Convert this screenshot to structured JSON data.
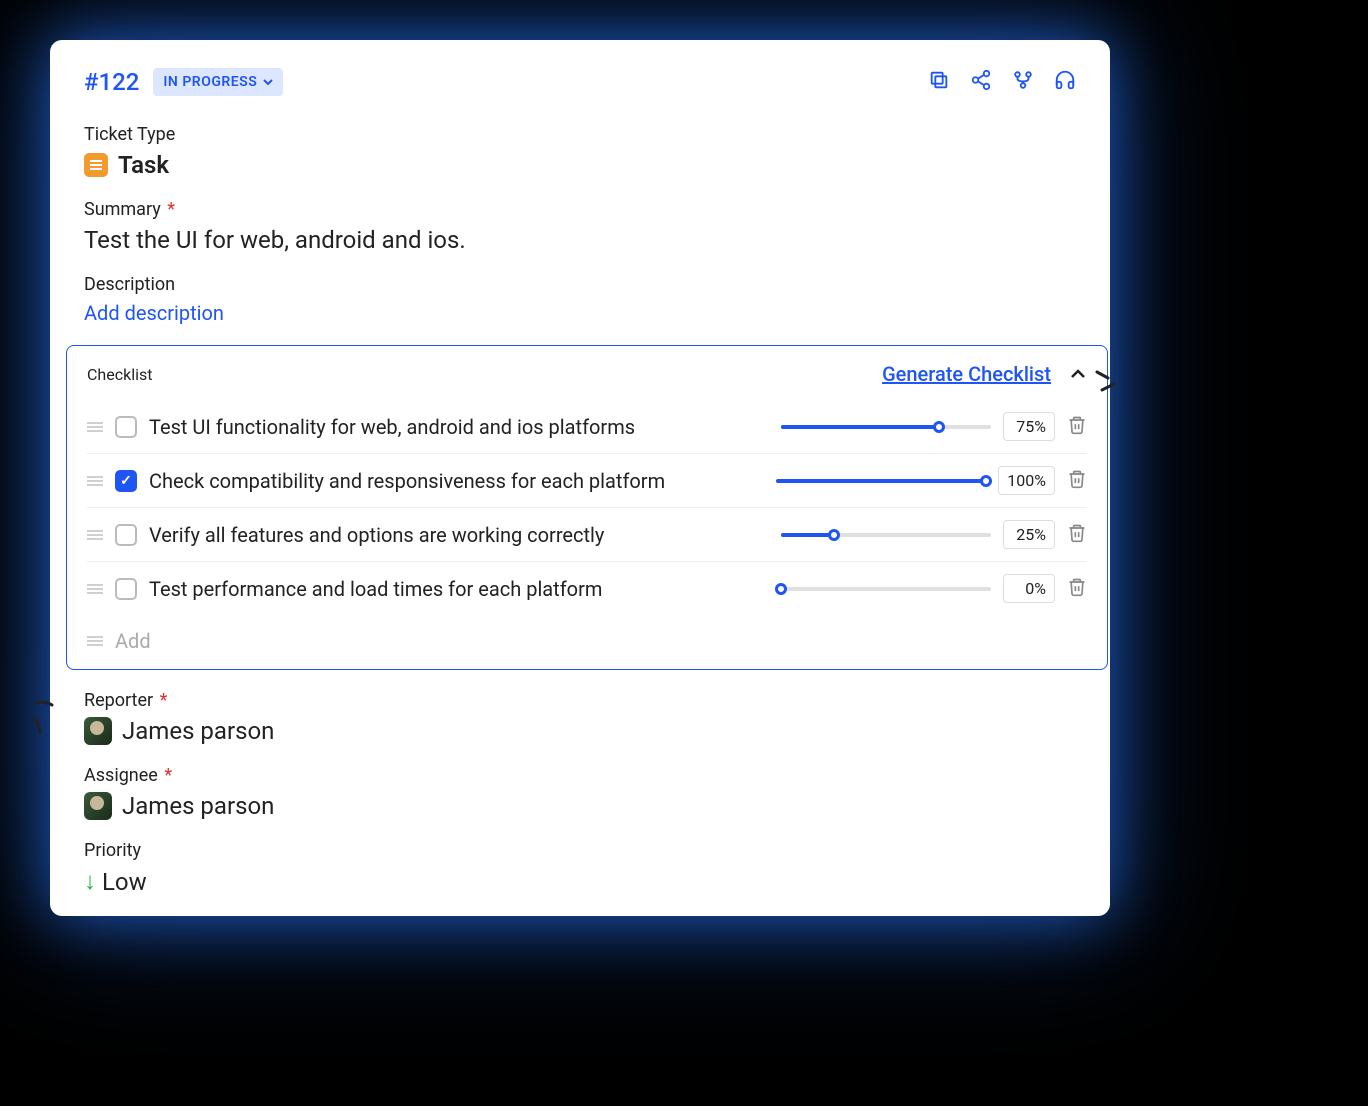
{
  "ticket": {
    "id": "#122",
    "status": "IN PROGRESS",
    "type_label": "Ticket Type",
    "type_value": "Task",
    "summary_label": "Summary",
    "summary_value": "Test the UI for web, android and ios.",
    "description_label": "Description",
    "add_description": "Add description"
  },
  "checklist": {
    "title": "Checklist",
    "generate": "Generate Checklist",
    "add_placeholder": "Add",
    "items": [
      {
        "text": "Test UI functionality for web, android and ios platforms",
        "checked": false,
        "pct": "75%",
        "pct_num": 75
      },
      {
        "text": "Check compatibility and responsiveness for each platform",
        "checked": true,
        "pct": "100%",
        "pct_num": 100
      },
      {
        "text": "Verify all features and options are working correctly",
        "checked": false,
        "pct": "25%",
        "pct_num": 25
      },
      {
        "text": "Test performance and load times for each platform",
        "checked": false,
        "pct": "0%",
        "pct_num": 0
      }
    ]
  },
  "reporter": {
    "label": "Reporter",
    "name": "James parson"
  },
  "assignee": {
    "label": "Assignee",
    "name": "James parson"
  },
  "priority": {
    "label": "Priority",
    "value": "Low"
  }
}
